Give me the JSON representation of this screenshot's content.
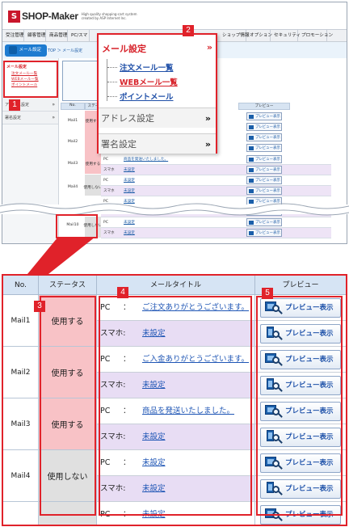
{
  "app": {
    "logo_mark": "S",
    "logo_name": "SHOP-Maker",
    "logo_tagline": "High quality shopping-cart system created by ASP Internet Inc."
  },
  "global_nav": [
    "受注管理",
    "顧客管理",
    "商品管理",
    "PC/スマ",
    "台帳",
    "ショップ情報",
    "オプション",
    "セキュリティ",
    "プロモーション"
  ],
  "sub_header": {
    "tab_label": "メール設定",
    "breadcrumb": "TOP ＞ メール設定"
  },
  "side_menu": {
    "title": "メール設定",
    "items": [
      "注文メール一覧",
      "WEBメール一覧",
      "ポイントメール"
    ],
    "sections": [
      "アドレス設定",
      "署名設定"
    ]
  },
  "popup": {
    "title": "メール設定",
    "links": [
      "注文メール一覧",
      "WEBメール一覧",
      "ポイントメール"
    ],
    "sections": [
      "アドレス設定",
      "署名設定"
    ]
  },
  "mini_table": {
    "headers": [
      "No.",
      "ステータス",
      "プレビュー"
    ],
    "rows": [
      {
        "no": "Mail1",
        "status": "使用する"
      },
      {
        "no": "Mail2",
        "status": "使用する"
      },
      {
        "no": "Mail3",
        "status": "使用する",
        "pc": "商品を発送いたしました。",
        "sp": "未設定"
      },
      {
        "no": "Mail4",
        "status": "使用しない",
        "pc": "未設定",
        "sp": "未設定"
      },
      {
        "no": "",
        "status": "",
        "pc": "未設定",
        "sp": "未設定"
      },
      {
        "no": "Mail10",
        "status": "使用しない",
        "pc": "未設定",
        "sp": "未設定"
      }
    ],
    "preview_label": "プレビュー表示",
    "pc_label": "PC",
    "sp_label": "スマホ"
  },
  "callouts": [
    "1",
    "2",
    "3",
    "4",
    "5"
  ],
  "zoom_table": {
    "headers": [
      "No.",
      "ステータス",
      "メールタイトル",
      "プレビュー"
    ],
    "pc_label": "PC",
    "colon": "：",
    "sp_label": "スマホ:",
    "preview_label": "プレビュー表示",
    "rows": [
      {
        "no": "Mail1",
        "status": "使用する",
        "state": "on",
        "pc_title": "ご注文ありがとうございます。",
        "sp_title": "未設定"
      },
      {
        "no": "Mail2",
        "status": "使用する",
        "state": "on",
        "pc_title": "ご入金ありがとうございます。",
        "sp_title": "未設定"
      },
      {
        "no": "Mail3",
        "status": "使用する",
        "state": "on",
        "pc_title": "商品を発送いたしました。",
        "sp_title": "未設定"
      },
      {
        "no": "Mail4",
        "status": "使用しない",
        "state": "off",
        "pc_title": "未設定",
        "sp_title": "未設定"
      },
      {
        "no": "",
        "status": "",
        "state": "off",
        "pc_title": "未設定",
        "sp_title": ""
      }
    ]
  },
  "colors": {
    "accent_red": "#e0222a",
    "link_blue": "#1f56b5",
    "status_on": "#f8c2c6",
    "status_off": "#e0e0e0",
    "sp_row": "#e8ddf4"
  }
}
